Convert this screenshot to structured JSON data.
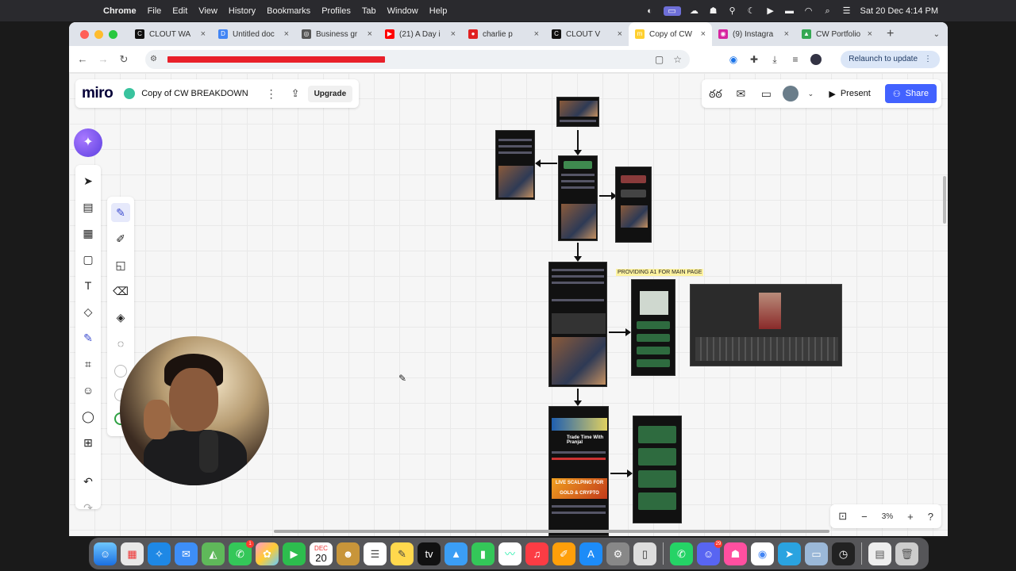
{
  "menubar": {
    "app": "Chrome",
    "items": [
      "File",
      "Edit",
      "View",
      "History",
      "Bookmarks",
      "Profiles",
      "Tab",
      "Window",
      "Help"
    ],
    "datetime": "Sat 20 Dec  4:14 PM"
  },
  "tabs": [
    {
      "title": "CLOUT WA",
      "color": "#111111",
      "icon": "C"
    },
    {
      "title": "Untitled doc",
      "color": "#4285f4",
      "icon": "D"
    },
    {
      "title": "Business gr",
      "color": "#555555",
      "icon": "◎"
    },
    {
      "title": "(21) A Day i",
      "color": "#ff0000",
      "icon": "▶"
    },
    {
      "title": "charlie p",
      "color": "#e02020",
      "icon": "●"
    },
    {
      "title": "CLOUT V",
      "color": "#111111",
      "icon": "C"
    },
    {
      "title": "Copy of CW",
      "color": "#ffd02f",
      "icon": "m"
    },
    {
      "title": "(9) Instagra",
      "color": "#d6249f",
      "icon": "◉"
    },
    {
      "title": "CW Portfolio",
      "color": "#34a853",
      "icon": "▲"
    }
  ],
  "active_tab_index": 6,
  "browser": {
    "relaunch_label": "Relaunch to update"
  },
  "miro": {
    "logo": "miro",
    "board_name": "Copy of CW BREAKDOWN",
    "upgrade_label": "Upgrade",
    "present_label": "Present",
    "share_label": "Share",
    "zoom": "3%",
    "reactions_label": "ఠఠ"
  },
  "board": {
    "annotation": "PROVIDING A1 FOR MAIN PAGE",
    "youtube_channel_title": "Trade Time With Pranjal",
    "promo_text": "LIVE SCALPING FOR GOLD & CRYPTO"
  },
  "dock": {
    "calendar_month": "DEC",
    "calendar_day": "20",
    "messages_badge": "1",
    "discord_badge": "29"
  },
  "colors": {
    "miro_blue": "#4262ff",
    "miro_accent": "#3d4dcf",
    "redaction": "#e8202a"
  }
}
